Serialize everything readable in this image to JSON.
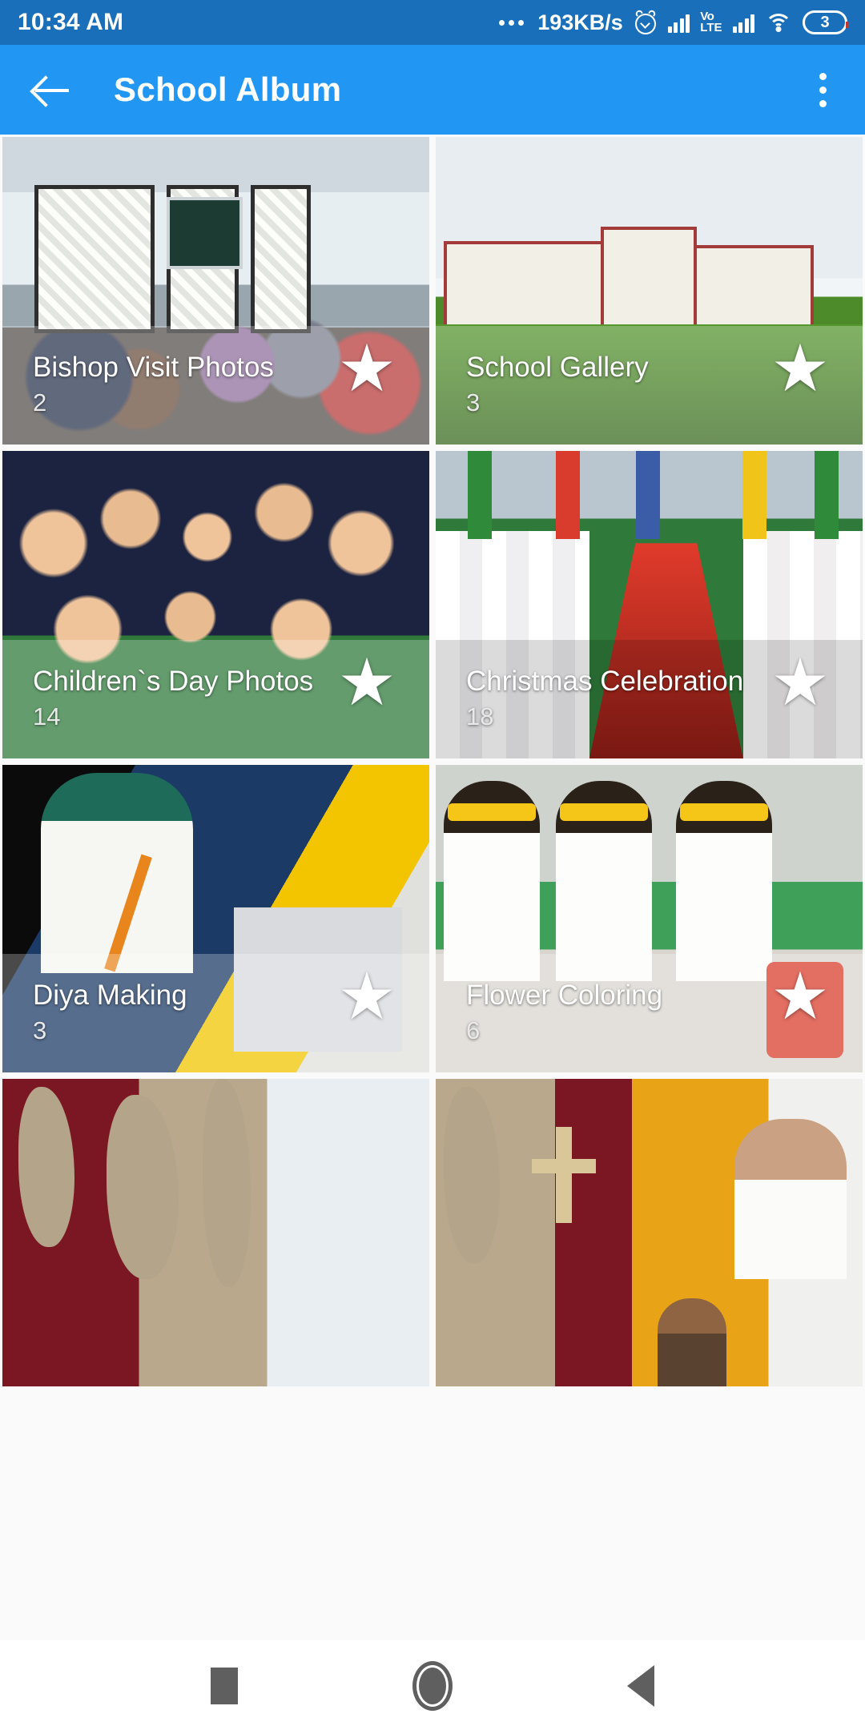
{
  "status_bar": {
    "time": "10:34 AM",
    "network_speed": "193KB/s",
    "volte_top": "Vo",
    "volte_bottom": "LTE",
    "battery_level": "3",
    "icons": [
      "more-dots-icon",
      "alarm-icon",
      "signal-bars-icon",
      "volte-icon",
      "signal-bars-icon",
      "wifi-icon",
      "battery-icon"
    ],
    "background_color": "#1a6fba"
  },
  "app_bar": {
    "title": "School Album",
    "back_icon": "back-arrow-icon",
    "overflow_icon": "more-vertical-icon",
    "background_color": "#2196f3",
    "text_color": "#ffffff"
  },
  "albums": [
    {
      "name": "Bishop Visit Photos",
      "count": "2",
      "starred": true,
      "star_icon": "star-icon",
      "thumb": "classroom-bishop-visit"
    },
    {
      "name": "School Gallery",
      "count": "3",
      "starred": true,
      "star_icon": "star-icon",
      "thumb": "school-building-ground"
    },
    {
      "name": "Children`s Day Photos",
      "count": "14",
      "starred": true,
      "star_icon": "star-icon",
      "thumb": "school-children-group"
    },
    {
      "name": "Christmas Celebration",
      "count": "18",
      "starred": true,
      "star_icon": "star-icon",
      "thumb": "christmas-red-carpet-procession"
    },
    {
      "name": "Diya Making",
      "count": "3",
      "starred": true,
      "star_icon": "star-icon",
      "thumb": "girl-drawing-diya"
    },
    {
      "name": "Flower Coloring",
      "count": "6",
      "starred": true,
      "star_icon": "star-icon",
      "thumb": "girls-making-paper-flowers"
    },
    {
      "name": "",
      "count": "",
      "starred": false,
      "star_icon": "",
      "thumb": "wall-carving-window"
    },
    {
      "name": "",
      "count": "",
      "starred": false,
      "star_icon": "",
      "thumb": "altar-cross-priest"
    }
  ],
  "nav_bar": {
    "recents_label": "recents-square-icon",
    "home_label": "home-circle-icon",
    "back_label": "back-triangle-icon",
    "background_color": "#ffffff"
  }
}
